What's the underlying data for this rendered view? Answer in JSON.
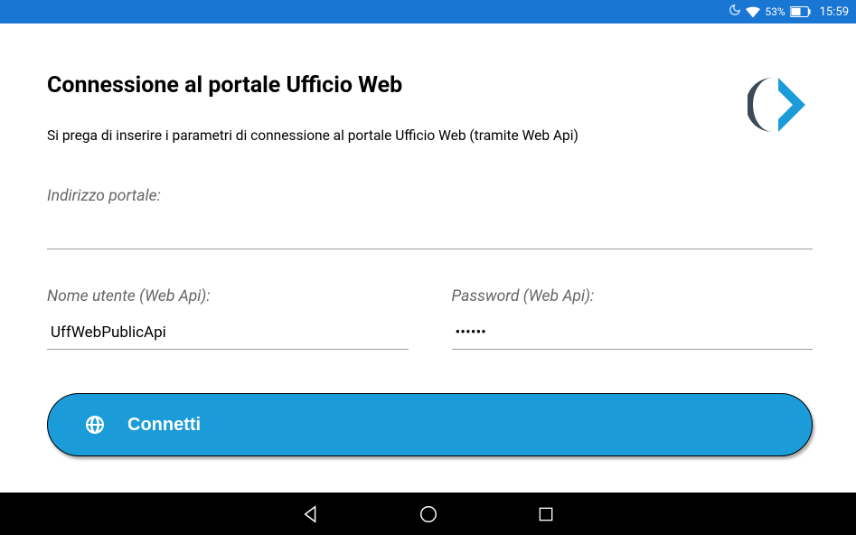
{
  "status": {
    "battery_pct": "53%",
    "clock": "15:59"
  },
  "page": {
    "title": "Connessione al portale Ufficio Web",
    "subtitle": "Si prega di inserire i parametri di connessione al portale Ufficio Web (tramite Web Api)"
  },
  "fields": {
    "portal_label": "Indirizzo portale:",
    "portal_value": "",
    "user_label": "Nome utente (Web Api):",
    "user_value": "UffWebPublicApi",
    "password_label": "Password (Web Api):",
    "password_value": "••••••"
  },
  "button": {
    "connect": "Connetti"
  },
  "colors": {
    "primary": "#1b9cd8",
    "status_bar": "#1976d2",
    "logo_dark": "#3b4a57"
  }
}
